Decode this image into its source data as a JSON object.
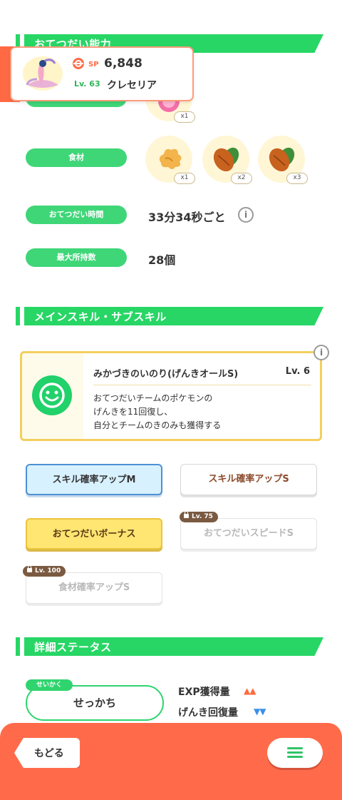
{
  "colors": {
    "accent_green": "#27d665",
    "bottom_bar": "#ff6b4a",
    "skill_border": "#f3cf5e"
  },
  "pokemon": {
    "sp_label": "SP",
    "sp_value": "6,848",
    "level": "Lv. 63",
    "name": "クレセリア",
    "avatar_icon": "cresselia-icon",
    "sp_icon": "pokeball-icon"
  },
  "helping": {
    "header": "おてつだい能力",
    "berry_qty": "x1",
    "ingredient_label": "食材",
    "ingredients": [
      {
        "icon": "ginger-icon",
        "qty": "x1"
      },
      {
        "icon": "cacao-icon",
        "qty": "x2"
      },
      {
        "icon": "cacao-icon",
        "qty": "x3"
      }
    ],
    "time_label": "おてつだい時間",
    "time_value": "33分34秒ごと",
    "info_glyph": "i",
    "max_carry_label": "最大所持数",
    "max_carry_value": "28個"
  },
  "skills": {
    "header": "メインスキル・サブスキル",
    "main": {
      "name": "みかづきのいのり(げんきオールS)",
      "level": "Lv. 6",
      "desc_line1": "おてつだいチームのポケモンの",
      "desc_line2": "げんきを11回復し、",
      "desc_line3": "自分とチームのきのみも獲得する",
      "icon": "smiley-icon"
    },
    "subskills": [
      {
        "label": "スキル確率アップM"
      },
      {
        "label": "スキル確率アップS"
      },
      {
        "label": "おてつだいボーナス"
      },
      {
        "label": "おてつだいスピードS",
        "lock": "Lv. 75"
      },
      {
        "label": "食材確率アップS",
        "lock": "Lv. 100"
      }
    ]
  },
  "status": {
    "header": "詳細ステータス",
    "nature_tag": "せいかく",
    "nature": "せっかち",
    "exp_label": "EXP獲得量",
    "exp_arrows": "▲▲",
    "energy_label": "げんき回復量",
    "energy_arrows": "▼▼"
  },
  "footer": {
    "back_label": "もどる",
    "menu_icon": "menu-icon"
  }
}
